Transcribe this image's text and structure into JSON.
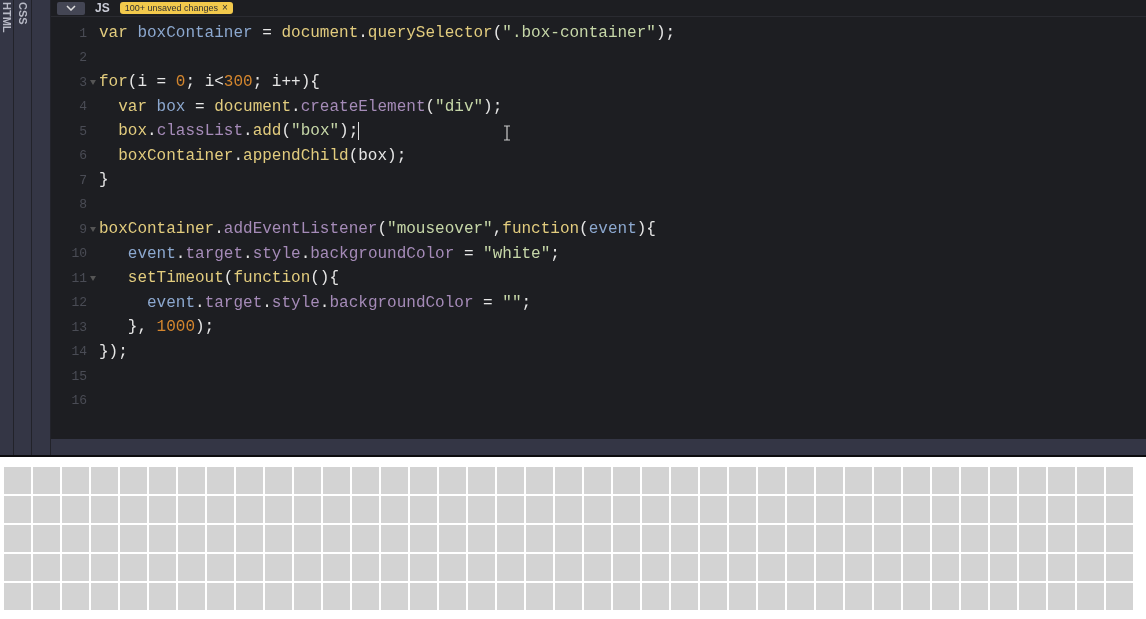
{
  "side_tabs": [
    {
      "label": "HTML",
      "selected": false
    },
    {
      "label": "CSS",
      "selected": false
    }
  ],
  "editor": {
    "title": "JS",
    "badge": {
      "text": "100+ unsaved changes",
      "close": "×"
    },
    "lines": [
      {
        "number": "1",
        "fold": false,
        "cursor": false,
        "tokens": [
          {
            "text": "var ",
            "kind": "kw"
          },
          {
            "text": "boxContainer",
            "kind": "var"
          },
          {
            "text": " = ",
            "kind": "punc"
          },
          {
            "text": "document",
            "kind": "obj"
          },
          {
            "text": ".",
            "kind": "punc"
          },
          {
            "text": "querySelector",
            "kind": "obj"
          },
          {
            "text": "(",
            "kind": "punc"
          },
          {
            "text": "\".box-container\"",
            "kind": "str"
          },
          {
            "text": ");",
            "kind": "punc"
          }
        ]
      },
      {
        "number": "2",
        "fold": false,
        "cursor": false
      },
      {
        "number": "3",
        "fold": true,
        "cursor": false,
        "tokens": [
          {
            "text": "for",
            "kind": "kw"
          },
          {
            "text": "(i = ",
            "kind": "punc"
          },
          {
            "text": "0",
            "kind": "num"
          },
          {
            "text": "; i<",
            "kind": "punc"
          },
          {
            "text": "300",
            "kind": "num"
          },
          {
            "text": "; i++){",
            "kind": "punc"
          }
        ]
      },
      {
        "number": "4",
        "fold": false,
        "cursor": false,
        "tokens": [
          {
            "text": "  var ",
            "kind": "kw"
          },
          {
            "text": "box",
            "kind": "var"
          },
          {
            "text": " = ",
            "kind": "punc"
          },
          {
            "text": "document",
            "kind": "obj"
          },
          {
            "text": ".",
            "kind": "punc"
          },
          {
            "text": "createElement",
            "kind": "prop"
          },
          {
            "text": "(",
            "kind": "punc"
          },
          {
            "text": "\"div\"",
            "kind": "str"
          },
          {
            "text": ");",
            "kind": "punc"
          }
        ]
      },
      {
        "number": "5",
        "fold": false,
        "cursor": true,
        "tokens": [
          {
            "text": "  box",
            "kind": "obj"
          },
          {
            "text": ".",
            "kind": "punc"
          },
          {
            "text": "classList",
            "kind": "prop"
          },
          {
            "text": ".",
            "kind": "punc"
          },
          {
            "text": "add",
            "kind": "obj"
          },
          {
            "text": "(",
            "kind": "punc"
          },
          {
            "text": "\"box\"",
            "kind": "str"
          },
          {
            "text": ");",
            "kind": "punc"
          }
        ]
      },
      {
        "number": "6",
        "fold": false,
        "cursor": false,
        "tokens": [
          {
            "text": "  boxContainer",
            "kind": "obj"
          },
          {
            "text": ".",
            "kind": "punc"
          },
          {
            "text": "appendChild",
            "kind": "obj"
          },
          {
            "text": "(box);",
            "kind": "punc"
          }
        ]
      },
      {
        "number": "7",
        "fold": false,
        "cursor": false,
        "tokens": [
          {
            "text": "}",
            "kind": "punc"
          }
        ]
      },
      {
        "number": "8",
        "fold": false,
        "cursor": false
      },
      {
        "number": "9",
        "fold": true,
        "cursor": false,
        "tokens": [
          {
            "text": "boxContainer",
            "kind": "obj"
          },
          {
            "text": ".",
            "kind": "punc"
          },
          {
            "text": "addEventListener",
            "kind": "prop"
          },
          {
            "text": "(",
            "kind": "punc"
          },
          {
            "text": "\"mouseover\"",
            "kind": "str"
          },
          {
            "text": ",",
            "kind": "punc"
          },
          {
            "text": "function",
            "kind": "kw"
          },
          {
            "text": "(",
            "kind": "punc"
          },
          {
            "text": "event",
            "kind": "var"
          },
          {
            "text": "){",
            "kind": "punc"
          }
        ]
      },
      {
        "number": "10",
        "fold": false,
        "cursor": false,
        "tokens": [
          {
            "text": "   event",
            "kind": "var"
          },
          {
            "text": ".",
            "kind": "punc"
          },
          {
            "text": "target",
            "kind": "prop"
          },
          {
            "text": ".",
            "kind": "punc"
          },
          {
            "text": "style",
            "kind": "prop"
          },
          {
            "text": ".",
            "kind": "punc"
          },
          {
            "text": "backgroundColor",
            "kind": "prop"
          },
          {
            "text": " = ",
            "kind": "punc"
          },
          {
            "text": "\"white\"",
            "kind": "str"
          },
          {
            "text": ";",
            "kind": "punc"
          }
        ]
      },
      {
        "number": "11",
        "fold": true,
        "cursor": false,
        "tokens": [
          {
            "text": "   setTimeout",
            "kind": "obj"
          },
          {
            "text": "(",
            "kind": "punc"
          },
          {
            "text": "function",
            "kind": "kw"
          },
          {
            "text": "(){",
            "kind": "punc"
          }
        ]
      },
      {
        "number": "12",
        "fold": false,
        "cursor": false,
        "tokens": [
          {
            "text": "     event",
            "kind": "var"
          },
          {
            "text": ".",
            "kind": "punc"
          },
          {
            "text": "target",
            "kind": "prop"
          },
          {
            "text": ".",
            "kind": "punc"
          },
          {
            "text": "style",
            "kind": "prop"
          },
          {
            "text": ".",
            "kind": "punc"
          },
          {
            "text": "backgroundColor",
            "kind": "prop"
          },
          {
            "text": " = ",
            "kind": "punc"
          },
          {
            "text": "\"\"",
            "kind": "str"
          },
          {
            "text": ";",
            "kind": "punc"
          }
        ]
      },
      {
        "number": "13",
        "fold": false,
        "cursor": false,
        "tokens": [
          {
            "text": "   }, ",
            "kind": "punc"
          },
          {
            "text": "1000",
            "kind": "num"
          },
          {
            "text": ");",
            "kind": "punc"
          }
        ]
      },
      {
        "number": "14",
        "fold": false,
        "cursor": false,
        "tokens": [
          {
            "text": "});",
            "kind": "punc"
          }
        ]
      },
      {
        "number": "15",
        "fold": false,
        "cursor": false
      },
      {
        "number": "16",
        "fold": false,
        "cursor": false
      }
    ]
  }
}
